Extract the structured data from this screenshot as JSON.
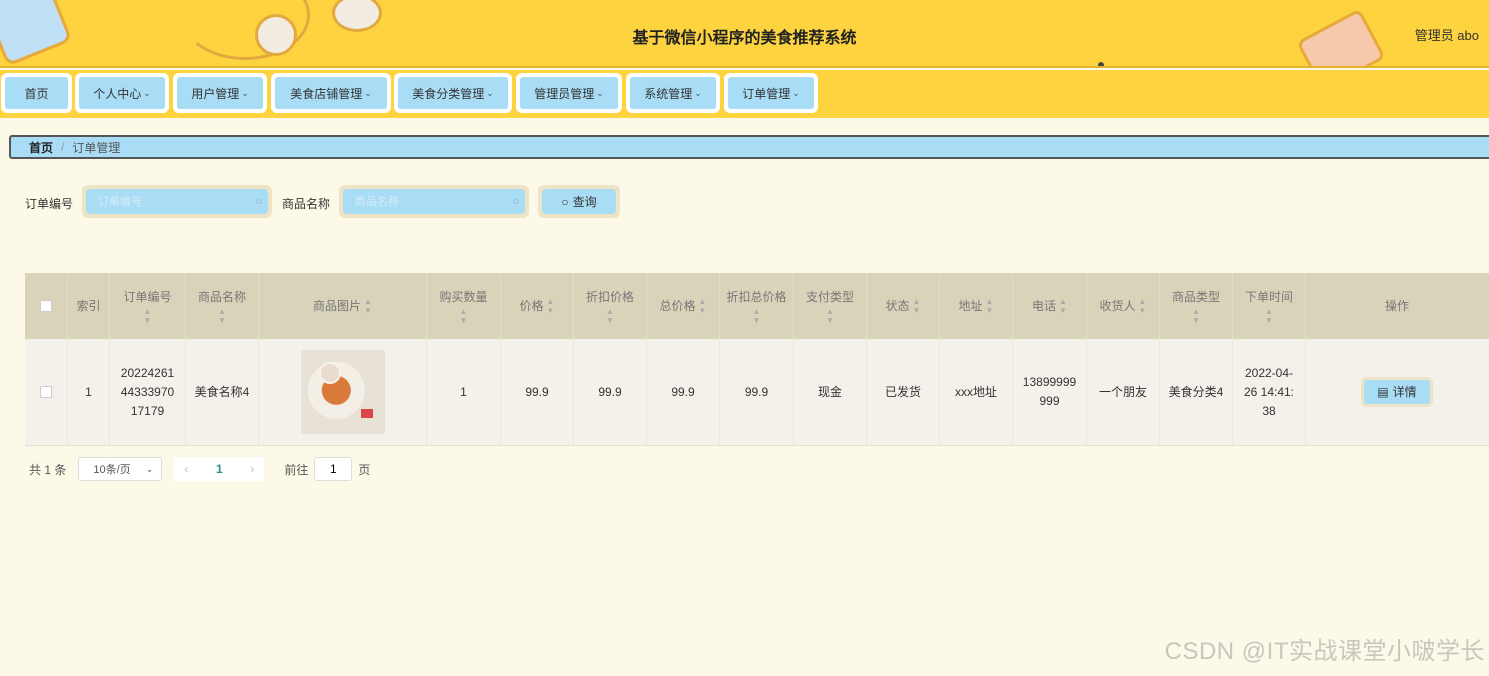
{
  "header": {
    "title": "基于微信小程序的美食推荐系统",
    "user": "管理员 abo"
  },
  "nav": [
    {
      "label": "首页",
      "dropdown": false
    },
    {
      "label": "个人中心",
      "dropdown": true
    },
    {
      "label": "用户管理",
      "dropdown": true
    },
    {
      "label": "美食店铺管理",
      "dropdown": true
    },
    {
      "label": "美食分类管理",
      "dropdown": true
    },
    {
      "label": "管理员管理",
      "dropdown": true
    },
    {
      "label": "系统管理",
      "dropdown": true
    },
    {
      "label": "订单管理",
      "dropdown": true
    }
  ],
  "breadcrumb": {
    "home": "首页",
    "separator": "/",
    "current": "订单管理"
  },
  "search": {
    "order_no_label": "订单编号",
    "order_no_placeholder": "订单编号",
    "product_label": "商品名称",
    "product_placeholder": "商品名称",
    "query_label": "查询"
  },
  "table": {
    "headers": [
      "索引",
      "订单编号",
      "商品名称",
      "商品图片",
      "购买数量",
      "价格",
      "折扣价格",
      "总价格",
      "折扣总价格",
      "支付类型",
      "状态",
      "地址",
      "电话",
      "收货人",
      "商品类型",
      "下单时间",
      "操作"
    ],
    "row": {
      "index": "1",
      "order_no": "20224261 44333970 17179",
      "product": "美食名称4",
      "quantity": "1",
      "price": "99.9",
      "discount_price": "99.9",
      "total": "99.9",
      "discount_total": "99.9",
      "pay_type": "现金",
      "status": "已发货",
      "address": "xxx地址",
      "phone": "13899999 999",
      "receiver": "一个朋友",
      "category": "美食分类4",
      "time": "2022-04- 26 14:41: 38",
      "action": "详情"
    }
  },
  "pagination": {
    "total": "共 1 条",
    "page_size": "10条/页",
    "current": "1",
    "goto_label": "前往",
    "goto_value": "1",
    "page_suffix": "页"
  },
  "watermark": "CSDN @IT实战课堂小啵学长",
  "colors": {
    "header": "#fdd43f",
    "accent": "#a9dcf5",
    "background": "#fdf9e8"
  }
}
